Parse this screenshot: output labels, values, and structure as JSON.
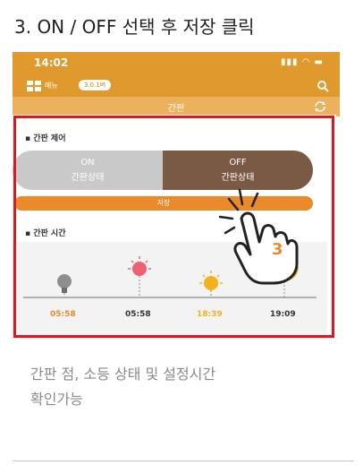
{
  "step": {
    "title": "3. ON / OFF 선택 후 저장 클릭"
  },
  "phone": {
    "status_time": "14:02",
    "status_icons": "▮▮▮ ◠ ▬",
    "menu_label": "메뉴",
    "version_badge": "3.0.1버",
    "screen_title": "간판",
    "control_section": "▪ 간판 제어",
    "toggle": {
      "on_label": "ON",
      "on_sub": "간판상태",
      "off_label": "OFF",
      "off_sub": "간판상태",
      "selected": "OFF"
    },
    "save_label": "저장",
    "time_section": "▪ 간판 시간",
    "times": [
      "05:58",
      "05:58",
      "18:39",
      "19:09"
    ],
    "colors": {
      "accent": "#e0992c",
      "off_selected": "#7b5a45",
      "save": "#ea8a2a",
      "frame": "#e3141b"
    }
  },
  "step_number": "3",
  "caption": {
    "line1": "간판 점, 소등 상태 및 설정시간",
    "line2": "확인가능"
  }
}
